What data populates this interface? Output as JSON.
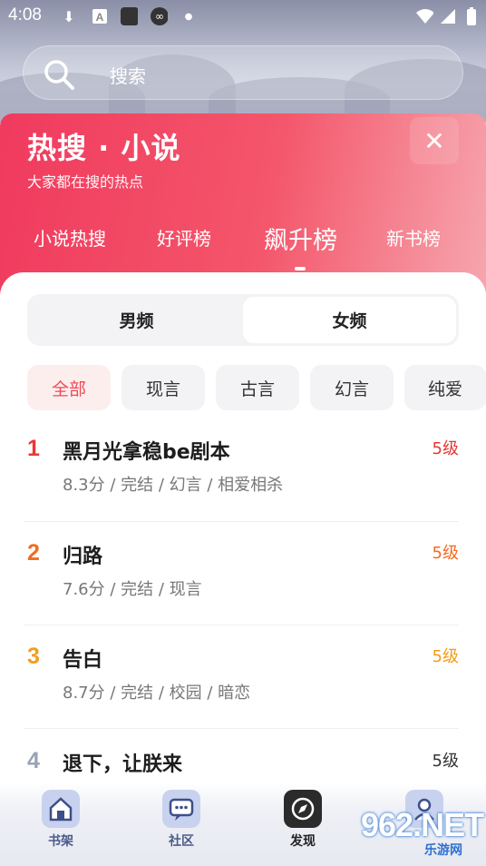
{
  "status": {
    "time": "4:08"
  },
  "search": {
    "placeholder": "搜索"
  },
  "header": {
    "title": "热搜 · 小说",
    "subtitle": "大家都在搜的热点",
    "tabs": [
      "小说热搜",
      "好评榜",
      "飙升榜",
      "新书榜"
    ],
    "active_tab": "飙升榜"
  },
  "gender": {
    "options": [
      "男频",
      "女频"
    ],
    "selected": "女频"
  },
  "filters": {
    "chips": [
      "全部",
      "现言",
      "古言",
      "幻言",
      "纯爱"
    ],
    "active": "全部"
  },
  "colors": {
    "accent": "#ef4a55",
    "rank1": "#e53935",
    "rank2": "#f36b21",
    "rank3": "#f59c1a",
    "rank4": "#9aa3b5"
  },
  "list": [
    {
      "rank": "1",
      "title": "黑月光拿稳be剧本",
      "meta": "8.3分 / 完结 / 幻言 / 相爱相杀",
      "level": "5级"
    },
    {
      "rank": "2",
      "title": "归路",
      "meta": "7.6分 / 完结 / 现言",
      "level": "5级"
    },
    {
      "rank": "3",
      "title": "告白",
      "meta": "8.7分 / 完结 / 校园 / 暗恋",
      "level": "5级"
    },
    {
      "rank": "4",
      "title": "退下，让朕来",
      "meta": "",
      "level": "5级"
    }
  ],
  "bottom_nav": [
    "书架",
    "社区",
    "发现"
  ],
  "watermark": {
    "logo": "962.NET",
    "sub": "乐游网"
  }
}
